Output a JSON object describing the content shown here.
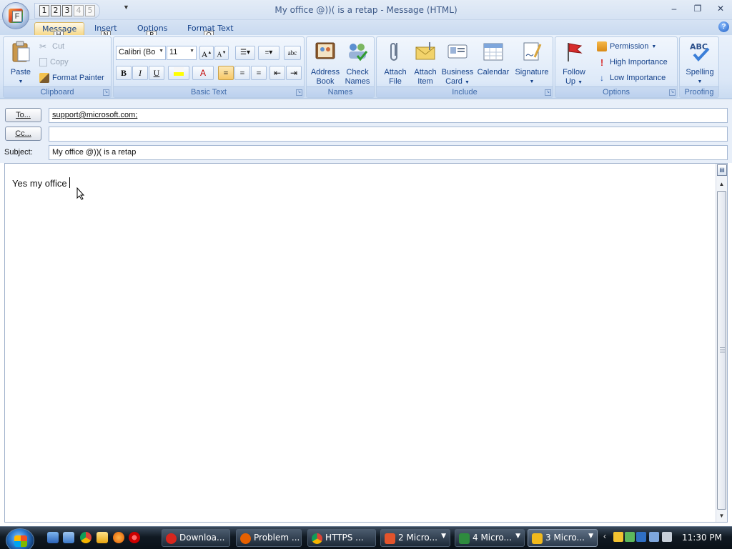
{
  "window": {
    "title": "My office @))( is a retap - Message (HTML)",
    "minimize": "–",
    "maximize": "❐",
    "close": "✕"
  },
  "office_button": {
    "keytip": "F"
  },
  "quick_access": {
    "keytips": [
      "1",
      "2",
      "3",
      "4",
      "5"
    ]
  },
  "tabs": [
    {
      "label": "Message",
      "keytip": "H"
    },
    {
      "label": "Insert",
      "keytip": "N"
    },
    {
      "label": "Options",
      "keytip": "P"
    },
    {
      "label": "Format Text",
      "keytip": "O"
    }
  ],
  "ribbon": {
    "clipboard": {
      "label": "Clipboard",
      "paste": "Paste",
      "cut": "Cut",
      "copy": "Copy",
      "format_painter": "Format Painter"
    },
    "basic_text": {
      "label": "Basic Text",
      "font": "Calibri (Bo",
      "size": "11",
      "bold": "B",
      "italic": "I",
      "underline": "U"
    },
    "names": {
      "label": "Names",
      "address_book_1": "Address",
      "address_book_2": "Book",
      "check_names_1": "Check",
      "check_names_2": "Names"
    },
    "include": {
      "label": "Include",
      "attach_file_1": "Attach",
      "attach_file_2": "File",
      "attach_item_1": "Attach",
      "attach_item_2": "Item",
      "business_card_1": "Business",
      "business_card_2": "Card",
      "calendar": "Calendar",
      "signature": "Signature"
    },
    "follow_up": {
      "line1": "Follow",
      "line2": "Up"
    },
    "options": {
      "label": "Options",
      "permission": "Permission",
      "high_importance": "High Importance",
      "low_importance": "Low Importance"
    },
    "proofing": {
      "label": "Proofing",
      "spelling": "Spelling"
    }
  },
  "header": {
    "to_button": "To...",
    "to_value": "support@microsoft.com;",
    "cc_button": "Cc...",
    "cc_value": "",
    "subject_label": "Subject:",
    "subject_value": "My office @))( is a retap"
  },
  "body": {
    "text": "Yes my office"
  },
  "taskbar": {
    "tasks": [
      {
        "label": "Downloa...",
        "color": "#d7261e"
      },
      {
        "label": "Problem ...",
        "color": "#e66000"
      },
      {
        "label": "HTTPS ...",
        "color": "#4a9b3d"
      },
      {
        "label": "2 Micro...",
        "color": "#e3542c"
      },
      {
        "label": "4 Micro...",
        "color": "#2e8b3e"
      },
      {
        "label": "3 Micro...",
        "color": "#f2b91c"
      }
    ],
    "clock": "11:30 PM"
  },
  "colors": {
    "ribbon_text": "#15428b",
    "active_tab": "#f6d889",
    "taskbar": "#101922"
  }
}
